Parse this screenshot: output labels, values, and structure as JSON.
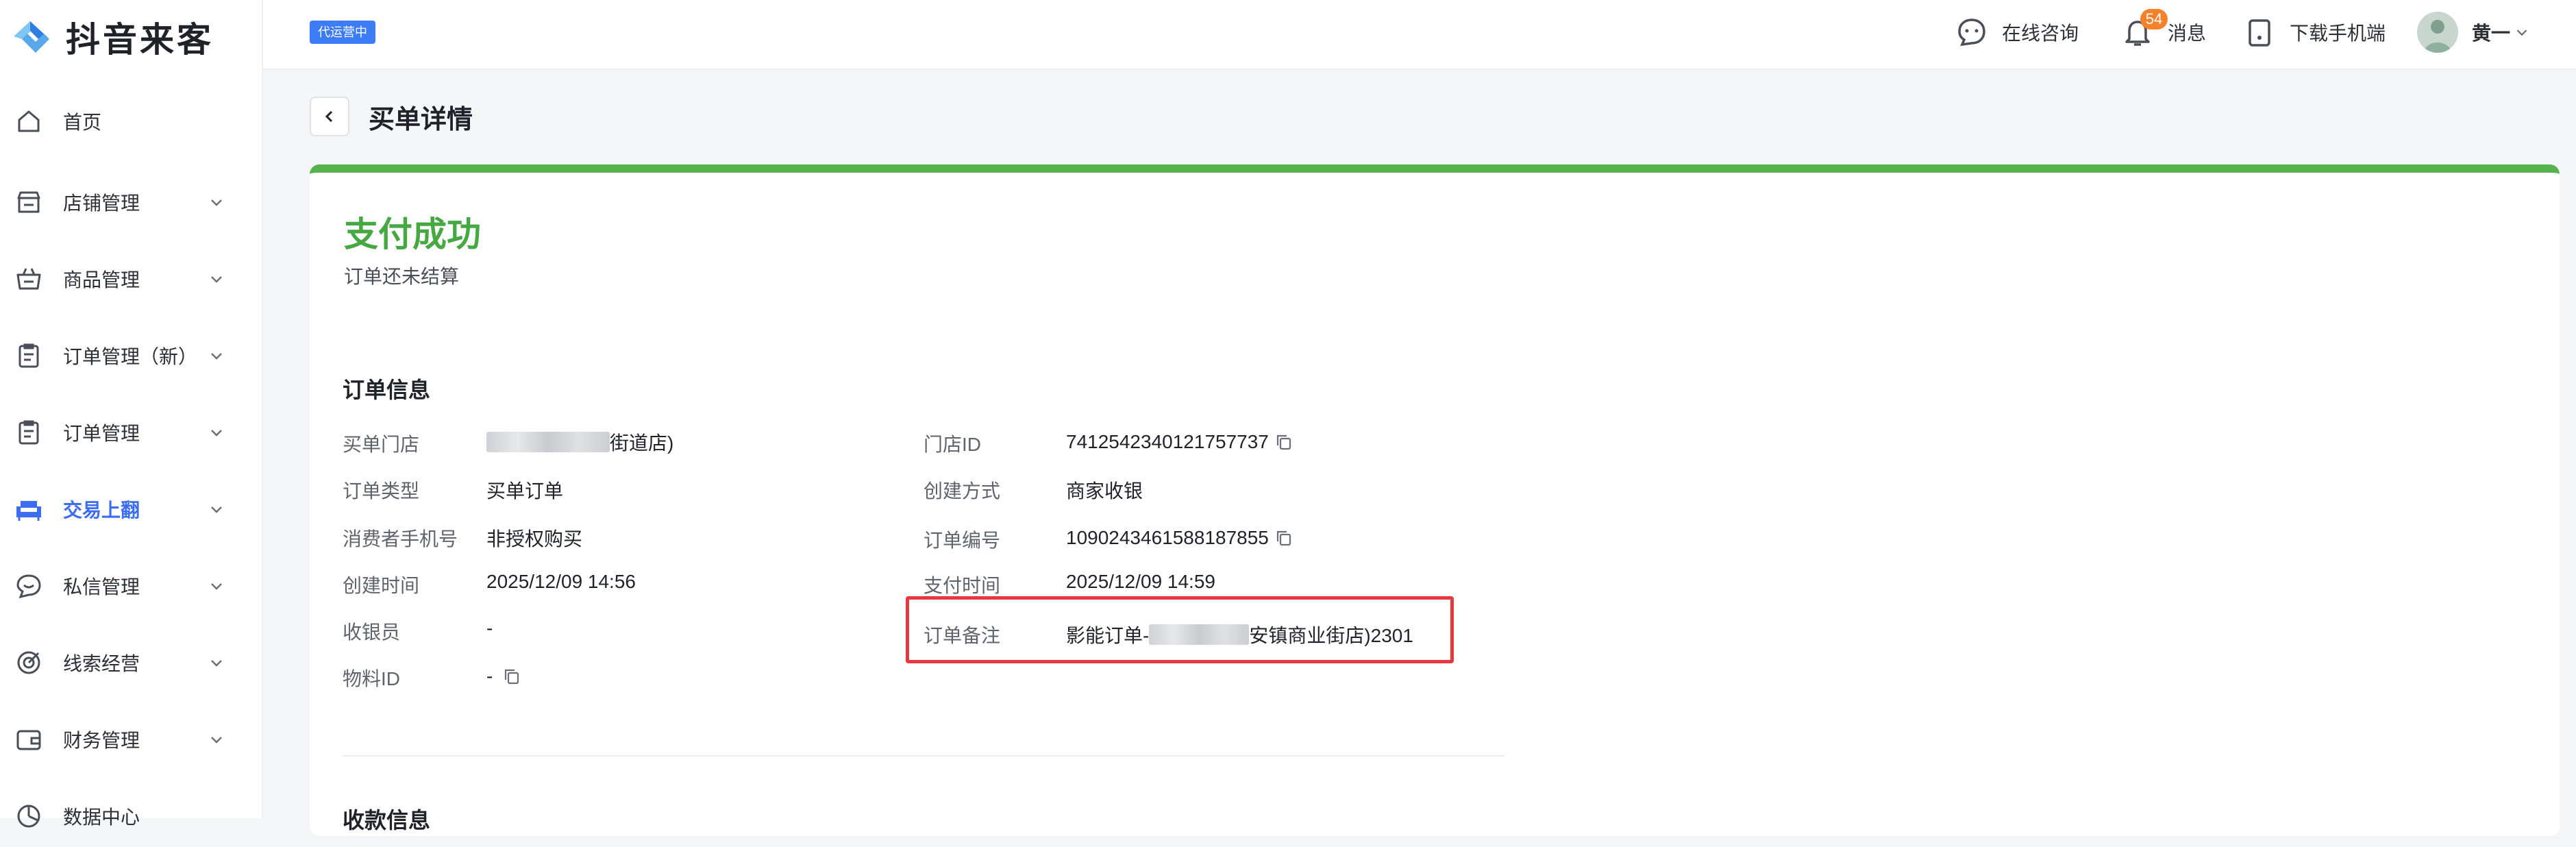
{
  "app": {
    "name": "抖音来客"
  },
  "sidebar": {
    "items": [
      {
        "label": "首页",
        "icon": "home-icon"
      },
      {
        "label": "店铺管理",
        "icon": "store-icon"
      },
      {
        "label": "商品管理",
        "icon": "basket-icon"
      },
      {
        "label": "订单管理（新）",
        "icon": "clipboard-icon"
      },
      {
        "label": "订单管理",
        "icon": "clipboard-icon"
      },
      {
        "label": "交易上翻",
        "icon": "sofa-icon",
        "active": true
      },
      {
        "label": "私信管理",
        "icon": "chat-icon"
      },
      {
        "label": "线索经营",
        "icon": "target-icon"
      },
      {
        "label": "财务管理",
        "icon": "wallet-icon"
      },
      {
        "label": "数据中心",
        "icon": "chart-icon"
      }
    ]
  },
  "header": {
    "ops_badge": "代运营中",
    "consult_label": "在线咨询",
    "messages_label": "消息",
    "messages_count": "54",
    "download_label": "下载手机端",
    "user_name": "黄一"
  },
  "page": {
    "title": "买单详情"
  },
  "status": {
    "title": "支付成功",
    "subtitle": "订单还未结算"
  },
  "order_info": {
    "section_title": "订单信息",
    "left": [
      {
        "label": "买单门店",
        "value": "街道店)"
      },
      {
        "label": "订单类型",
        "value": "买单订单"
      },
      {
        "label": "消费者手机号",
        "value": "非授权购买"
      },
      {
        "label": "创建时间",
        "value": "2025/12/09 14:56"
      },
      {
        "label": "收银员",
        "value": "-"
      },
      {
        "label": "物料ID",
        "value": "-"
      }
    ],
    "right": [
      {
        "label": "门店ID",
        "value": "7412542340121757737"
      },
      {
        "label": "创建方式",
        "value": "商家收银"
      },
      {
        "label": "订单编号",
        "value": "1090243461588187855"
      },
      {
        "label": "支付时间",
        "value": "2025/12/09 14:59"
      },
      {
        "label": "订单备注",
        "value_prefix": "影能订单-",
        "value_suffix": "安镇商业街店)2301"
      }
    ]
  },
  "payment_info": {
    "section_title": "收款信息"
  },
  "colors": {
    "accent": "#3c6df0",
    "success": "#45a842",
    "highlight": "#e5393f",
    "badge": "#f5822a"
  }
}
